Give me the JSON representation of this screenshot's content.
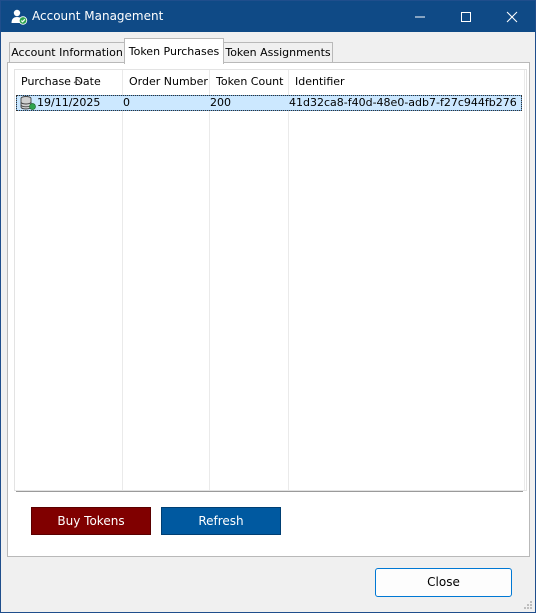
{
  "window": {
    "title": "Account Management",
    "title_icon": "account-icon"
  },
  "title_controls": [
    "minimize-icon",
    "maximize-icon",
    "close-icon"
  ],
  "tabs": [
    {
      "label": "Account Information",
      "active": false
    },
    {
      "label": "Token Purchases",
      "active": true
    },
    {
      "label": "Token Assignments",
      "active": false
    }
  ],
  "table": {
    "columns": [
      "Purchase Date",
      "Order Number",
      "Token Count",
      "Identifier"
    ],
    "sorted_column": "Purchase Date",
    "sort_indicator": "chevron-up-icon",
    "rows": [
      {
        "icon": "database-icon",
        "purchase_date": "19/11/2025",
        "order_number": "0",
        "token_count": "200",
        "identifier": "41d32ca8-f40d-48e0-adb7-f27c944fb276",
        "selected": true
      }
    ]
  },
  "buttons": {
    "buy": "Buy Tokens",
    "refresh": "Refresh",
    "close": "Close"
  },
  "colors": {
    "titlebar": "#0f4a86",
    "buy_button": "#800000",
    "refresh_button": "#0059a0",
    "selection": "#cce8ff"
  }
}
